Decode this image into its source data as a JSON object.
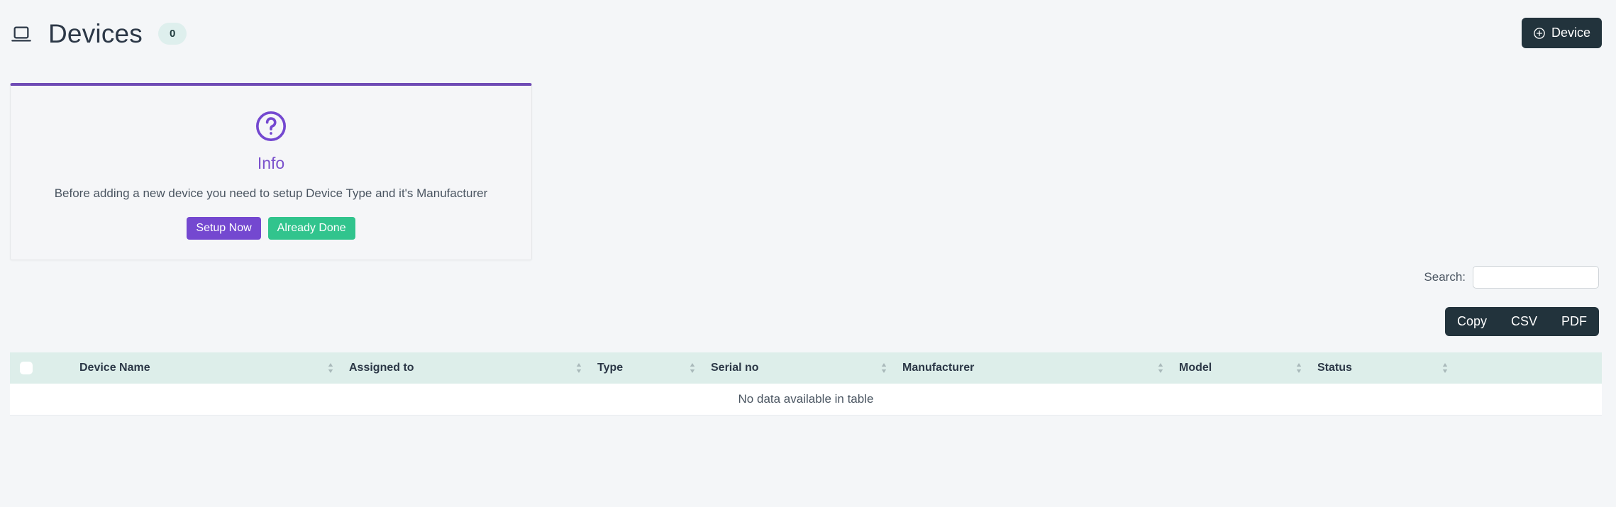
{
  "header": {
    "icon": "laptop-icon",
    "title": "Devices",
    "count_badge": "0",
    "add_button": {
      "label": "Device",
      "icon": "plus-circle-icon"
    }
  },
  "info_card": {
    "icon": "question-circle-icon",
    "heading": "Info",
    "message": "Before adding a new device you need to setup Device Type and it's Manufacturer",
    "primary_button": "Setup Now",
    "secondary_button": "Already Done"
  },
  "search": {
    "label": "Search:",
    "value": "",
    "placeholder": ""
  },
  "export": {
    "copy": "Copy",
    "csv": "CSV",
    "pdf": "PDF"
  },
  "table": {
    "columns": [
      "Device Name",
      "Assigned to",
      "Type",
      "Serial no",
      "Manufacturer",
      "Model",
      "Status"
    ],
    "rows": [],
    "empty_message": "No data available in table"
  },
  "colors": {
    "page_background": "#f4f6f8",
    "dark_button": "#22333c",
    "badge_background": "#deefed",
    "accent_purple": "#7448d0",
    "accent_green": "#31c48d",
    "table_header": "#ddeeea",
    "card_top_border": "#6f4bb5"
  }
}
